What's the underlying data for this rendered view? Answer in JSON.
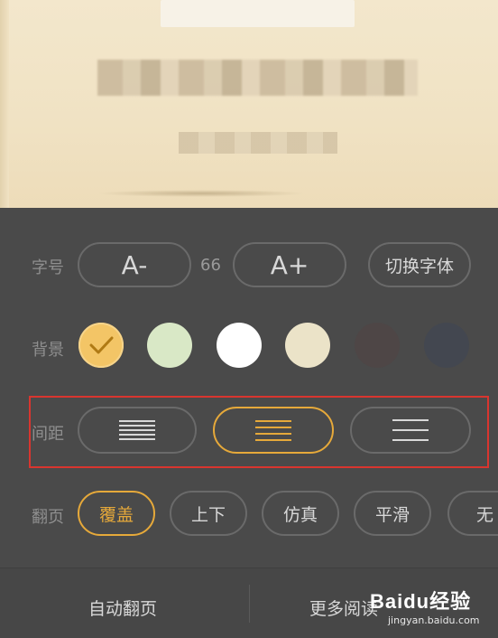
{
  "font_row": {
    "label": "字号",
    "decrease_label": "A-",
    "size_value": "66",
    "increase_label": "A+",
    "switch_font_label": "切换字体"
  },
  "background_row": {
    "label": "背景",
    "swatches": [
      {
        "color": "#f3c566",
        "selected": true
      },
      {
        "color": "#d9e8c6",
        "selected": false
      },
      {
        "color": "#ffffff",
        "selected": false
      },
      {
        "color": "#ebe3c8",
        "selected": false
      },
      {
        "color": "#4e4646",
        "selected": false
      },
      {
        "color": "#434750",
        "selected": false
      }
    ]
  },
  "spacing_row": {
    "label": "间距",
    "options": [
      {
        "icon": "spacing-compact-icon",
        "selected": false
      },
      {
        "icon": "spacing-medium-icon",
        "selected": true
      },
      {
        "icon": "spacing-loose-icon",
        "selected": false
      }
    ]
  },
  "page_turn_row": {
    "label": "翻页",
    "options": [
      {
        "label": "覆盖",
        "selected": true
      },
      {
        "label": "上下",
        "selected": false
      },
      {
        "label": "仿真",
        "selected": false
      },
      {
        "label": "平滑",
        "selected": false
      },
      {
        "label": "无",
        "selected": false
      }
    ]
  },
  "bottom_bar": {
    "auto_page_label": "自动翻页",
    "more_settings_label": "更多阅读"
  },
  "watermark": {
    "brand": "Baidu经验",
    "url": "jingyan.baidu.com"
  },
  "colors": {
    "panel_bg": "#4a4a4a",
    "accent": "#e6a93a",
    "highlight_border": "#d9352f"
  }
}
